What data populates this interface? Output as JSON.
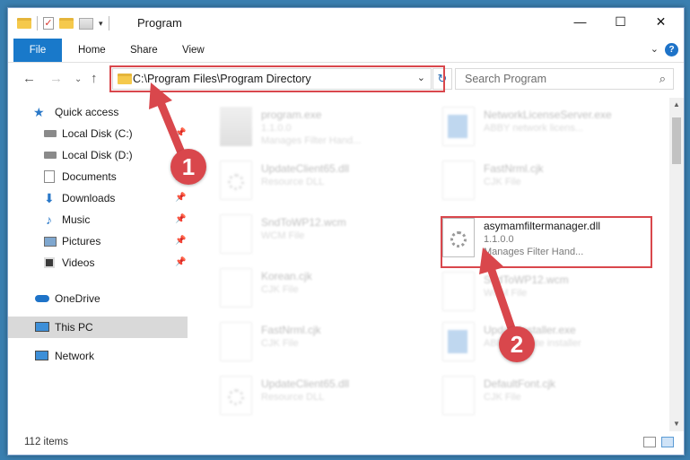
{
  "window": {
    "title": "Program",
    "controls": {
      "minimize": "—",
      "maximize": "☐",
      "close": "✕"
    }
  },
  "ribbon": {
    "tabs": [
      {
        "label": "File"
      },
      {
        "label": "Home"
      },
      {
        "label": "Share"
      },
      {
        "label": "View"
      }
    ],
    "help": "?"
  },
  "address": {
    "path": "C:\\Program Files\\Program Directory",
    "search_placeholder": "Search Program"
  },
  "nav": {
    "items": [
      {
        "label": "Quick access",
        "icon": "star-icon"
      },
      {
        "label": "Local Disk (C:)",
        "icon": "drive-icon"
      },
      {
        "label": "Local Disk (D:)",
        "icon": "drive-icon"
      },
      {
        "label": "Documents",
        "icon": "documents-icon"
      },
      {
        "label": "Downloads",
        "icon": "download-icon"
      },
      {
        "label": "Music",
        "icon": "music-icon"
      },
      {
        "label": "Pictures",
        "icon": "pictures-icon"
      },
      {
        "label": "Videos",
        "icon": "videos-icon"
      },
      {
        "label": "OneDrive",
        "icon": "cloud-icon"
      },
      {
        "label": "This PC",
        "icon": "computer-icon"
      },
      {
        "label": "Network",
        "icon": "network-icon"
      }
    ]
  },
  "files": [
    {
      "name": "program.exe",
      "d1": "1.1.0.0",
      "d2": "Manages Filter Hand..."
    },
    {
      "name": "NetworkLicenseServer.exe",
      "d1": "ABBY network licens...",
      "d2": ""
    },
    {
      "name": "UpdateClient65.dll",
      "d1": "Resource DLL",
      "d2": ""
    },
    {
      "name": "FastNrml.cjk",
      "d1": "CJK File",
      "d2": ""
    },
    {
      "name": "SndToWP12.wcm",
      "d1": "WCM File",
      "d2": ""
    },
    {
      "name": "asymamfiltermanager.dll",
      "d1": "1.1.0.0",
      "d2": "Manages Filter Hand..."
    },
    {
      "name": "Korean.cjk",
      "d1": "CJK File",
      "d2": ""
    },
    {
      "name": "SndToWP12.wcm",
      "d1": "WCM File",
      "d2": ""
    },
    {
      "name": "FastNrml.cjk",
      "d1": "CJK File",
      "d2": ""
    },
    {
      "name": "UpdateInstaller.exe",
      "d1": "ABBY Update installer",
      "d2": ""
    },
    {
      "name": "UpdateClient65.dll",
      "d1": "Resource DLL",
      "d2": ""
    },
    {
      "name": "DefaultFont.cjk",
      "d1": "CJK File",
      "d2": ""
    }
  ],
  "status": {
    "count": "112 items"
  },
  "annotations": {
    "step1": "1",
    "step2": "2",
    "accent_color": "#d9474c"
  }
}
